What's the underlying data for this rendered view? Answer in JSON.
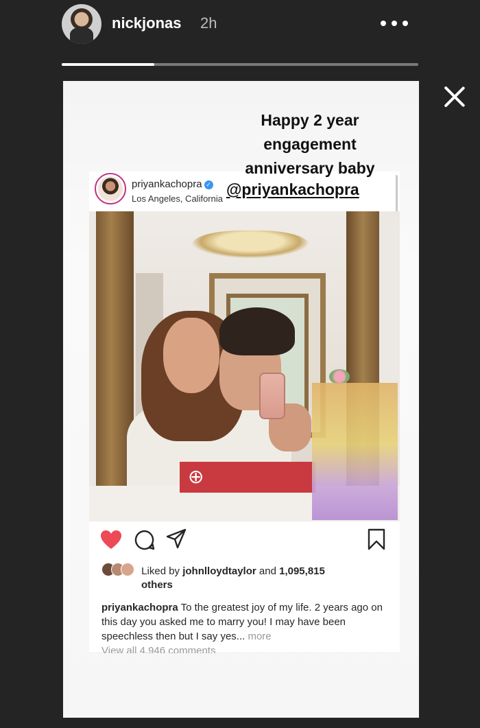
{
  "story": {
    "username": "nickjonas",
    "timestamp": "2h",
    "progress_fraction": 0.26
  },
  "sticker": {
    "lines": [
      "Happy 2 year",
      "engagement",
      "anniversary baby"
    ],
    "mention": "@priyankachopra"
  },
  "post": {
    "username": "priyankachopra",
    "location": "Los Angeles, California",
    "likes": {
      "prefix": "Liked by",
      "user": "johnlloydtaylor",
      "middle": "and",
      "count": "1,095,815",
      "suffix": "others"
    },
    "caption": {
      "author": "priyankachopra",
      "text": "To the greatest joy of my life. 2 years ago on this day you asked me to marry you! I may have been speechless then but I say yes...",
      "more": "more"
    },
    "view_comments": "View all 4,946 comments"
  },
  "colors": {
    "background": "#242424",
    "heart": "#ed4956",
    "verified": "#3897f0"
  },
  "icons": [
    "more-icon",
    "close-icon",
    "verified-icon",
    "heart-icon",
    "comment-icon",
    "share-icon",
    "save-icon"
  ]
}
